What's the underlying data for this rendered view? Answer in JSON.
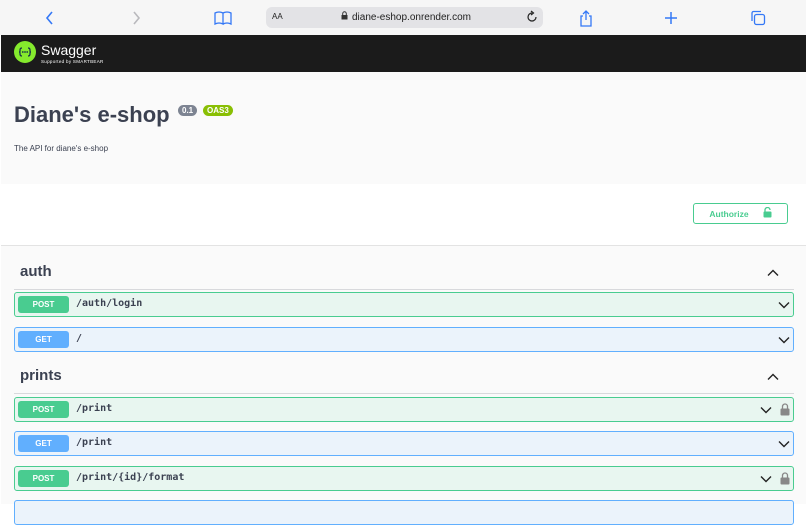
{
  "browser": {
    "text_size_label": "AA",
    "url": "diane-eshop.onrender.com"
  },
  "swagger": {
    "brand": "Swagger",
    "sub": "Supported by SMARTBEAR"
  },
  "info": {
    "title": "Diane's e-shop",
    "version": "0.1",
    "oas": "OAS3",
    "description": "The API for diane's e-shop"
  },
  "authorize_label": "Authorize",
  "colors": {
    "post": "#49cc90",
    "get": "#61affe",
    "header_bg": "#1b1b1b",
    "swagger_green": "#85ea2d"
  },
  "tags": [
    {
      "name": "auth",
      "operations": [
        {
          "method": "POST",
          "path": "/auth/login",
          "locked": false
        },
        {
          "method": "GET",
          "path": "/",
          "locked": false
        }
      ]
    },
    {
      "name": "prints",
      "operations": [
        {
          "method": "POST",
          "path": "/print",
          "locked": true
        },
        {
          "method": "GET",
          "path": "/print",
          "locked": false
        },
        {
          "method": "POST",
          "path": "/print/{id}/format",
          "locked": true
        }
      ]
    }
  ]
}
